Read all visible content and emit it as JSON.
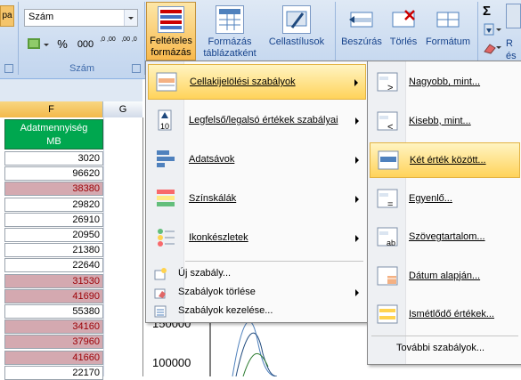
{
  "ribbon": {
    "partial_left_label": "pa",
    "number_format": "Szám",
    "currency_symbol": "%",
    "thousands": "000",
    "inc_decimal": ",0 ,00",
    "dec_decimal": ",00 ,0",
    "group_number": "Szám",
    "cond_format_label_1": "Feltételes",
    "cond_format_label_2": "formázás",
    "table_format_label_1": "Formázás",
    "table_format_label_2": "táblázatként",
    "cell_styles_label": "Cellastílusok",
    "insert_label": "Beszúrás",
    "delete_label": "Törlés",
    "format_label": "Formátum",
    "sigma": "Σ",
    "partial_right_1": "R",
    "partial_right_2": "és"
  },
  "sheet": {
    "column_f": "F",
    "column_g": "G",
    "header_line1": "Adatmennyiség",
    "header_line2": "MB",
    "values": [
      "3020",
      "96620",
      "38380",
      "29820",
      "26910",
      "20950",
      "21380",
      "22640",
      "31530",
      "41690",
      "55380",
      "34160",
      "37960",
      "41660",
      "22170"
    ],
    "highlighted": [
      false,
      false,
      true,
      false,
      false,
      false,
      false,
      false,
      true,
      true,
      false,
      true,
      true,
      true,
      false
    ],
    "chart_tick_1": "150000",
    "chart_tick_2": "100000"
  },
  "menu_main": {
    "items": [
      {
        "label": "Cellakijelölési szabályok",
        "icon": "highlight-cells-rules-icon"
      },
      {
        "label": "Legfelső/legalsó értékek szabályai",
        "icon": "top-bottom-rules-icon"
      },
      {
        "label": "Adatsávok",
        "icon": "data-bars-icon"
      },
      {
        "label": "Színskálák",
        "icon": "color-scales-icon"
      },
      {
        "label": "Ikonkészletek",
        "icon": "icon-sets-icon"
      }
    ],
    "small_items": [
      {
        "label": "Új szabály...",
        "icon": "new-rule-icon"
      },
      {
        "label": "Szabályok törlése",
        "icon": "clear-rules-icon"
      },
      {
        "label": "Szabályok kezelése...",
        "icon": "manage-rules-icon"
      }
    ]
  },
  "menu_sub": {
    "items": [
      {
        "label": "Nagyobb, mint...",
        "icon": "greater-than-icon"
      },
      {
        "label": "Kisebb, mint...",
        "icon": "less-than-icon"
      },
      {
        "label": "Két érték között...",
        "icon": "between-icon"
      },
      {
        "label": "Egyenlő...",
        "icon": "equal-to-icon"
      },
      {
        "label": "Szövegtartalom...",
        "icon": "text-contains-icon"
      },
      {
        "label": "Dátum alapján...",
        "icon": "date-occurring-icon"
      },
      {
        "label": "Ismétlődő értékek...",
        "icon": "duplicate-values-icon"
      }
    ],
    "more_rules": "További szabályok..."
  },
  "colors": {
    "ribbon_bg": "#c9daf0",
    "selected_hover": "#ffd35a",
    "highlight_fill": "#d4a9b0",
    "highlight_text": "#9c0006",
    "header_green": "#00a74f"
  }
}
